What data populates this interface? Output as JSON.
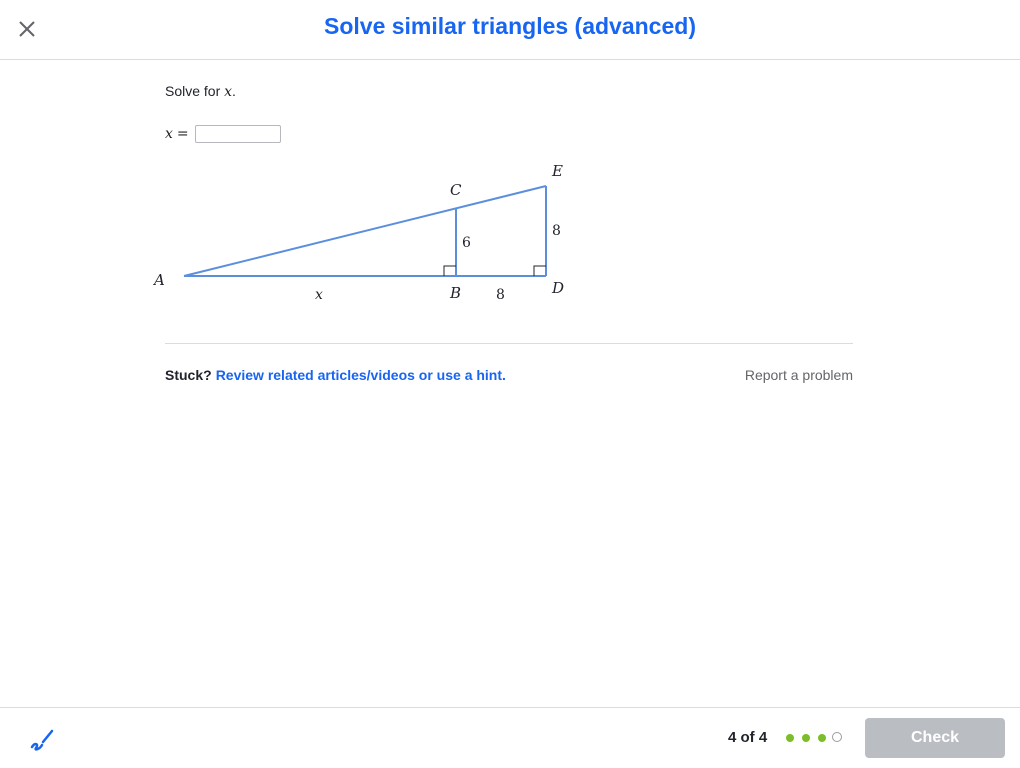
{
  "header": {
    "title": "Solve similar triangles (advanced)",
    "close_icon": "close-icon"
  },
  "question": {
    "prompt_prefix": "Solve for ",
    "prompt_var": "x",
    "prompt_suffix": ".",
    "answer_var": "x",
    "answer_eq": "=",
    "answer_value": ""
  },
  "diagram": {
    "labels": {
      "A": "A",
      "B": "B",
      "C": "C",
      "D": "D",
      "E": "E",
      "AB": "x",
      "BC": "6",
      "BD": "8",
      "DE": "8"
    },
    "stroke_color": "#5b8fde"
  },
  "help": {
    "stuck": "Stuck?",
    "hint_link": "Review related articles/videos or use a hint.",
    "report": "Report a problem"
  },
  "footer": {
    "scratchpad_icon": "scratchpad-icon",
    "progress_text": "4 of 4",
    "progress_dots": [
      "done",
      "done",
      "done",
      "empty"
    ],
    "check_label": "Check"
  },
  "colors": {
    "accent": "#1865f2",
    "progress": "#7bbd2a",
    "disabled_button": "#babec2"
  }
}
